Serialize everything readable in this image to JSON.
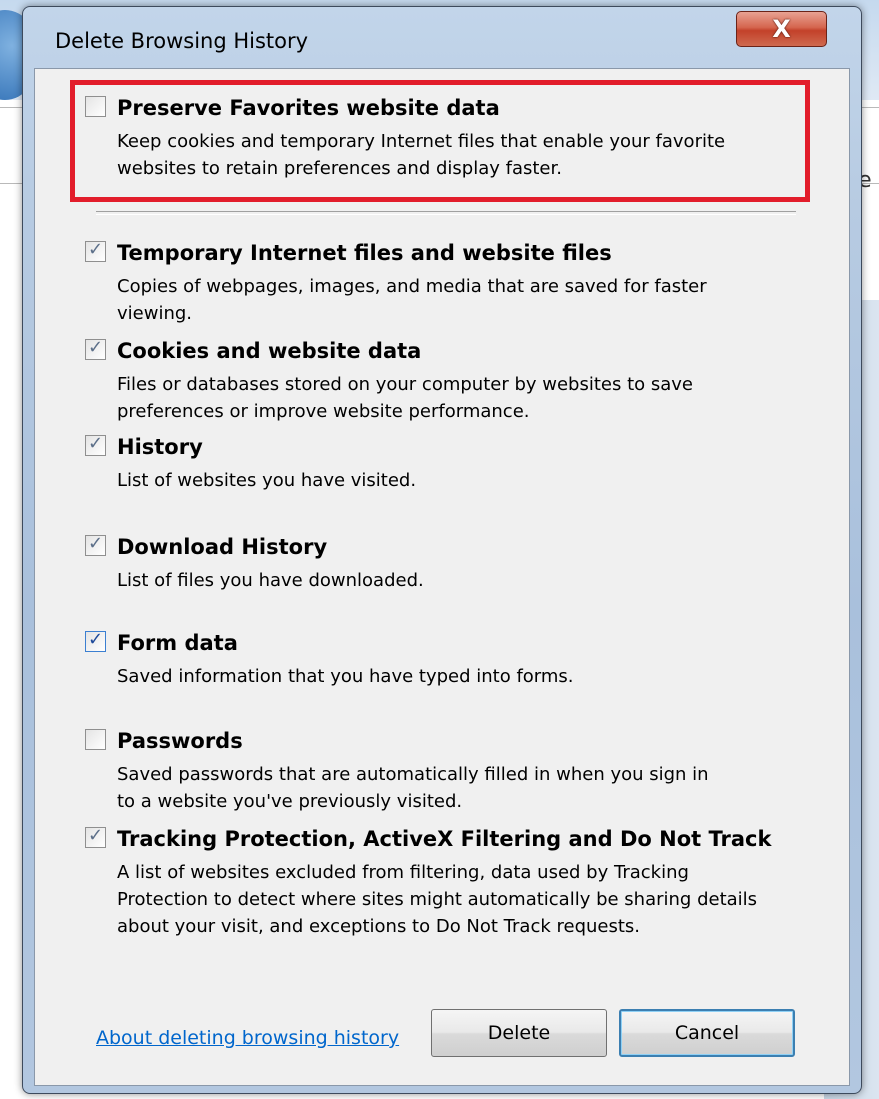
{
  "dialog": {
    "title": "Delete Browsing History",
    "close_label": "X"
  },
  "background": {
    "partial_text": "le"
  },
  "preserve": {
    "checked": false,
    "title": "Preserve Favorites website data",
    "desc": [
      "Keep cookies and temporary Internet files that enable your favorite",
      "websites to retain preferences and display faster."
    ]
  },
  "items": [
    {
      "checked": true,
      "title": "Temporary Internet files and website files",
      "desc": [
        "Copies of webpages, images, and media that are saved for faster",
        "viewing."
      ]
    },
    {
      "checked": true,
      "title": "Cookies and website data",
      "desc": [
        "Files or databases stored on your computer by websites to save",
        "preferences or improve website performance."
      ]
    },
    {
      "checked": true,
      "title": "History",
      "desc": [
        "List of websites you have visited."
      ]
    },
    {
      "checked": true,
      "title": "Download History",
      "desc": [
        "List of files you have downloaded."
      ]
    },
    {
      "checked": true,
      "title": "Form data",
      "desc": [
        "Saved information that you have typed into forms."
      ]
    },
    {
      "checked": false,
      "title": "Passwords",
      "desc": [
        "Saved passwords that are automatically filled in when you sign in",
        "to a website you've previously visited."
      ]
    },
    {
      "checked": true,
      "title": "Tracking Protection, ActiveX Filtering and Do Not Track",
      "desc": [
        "A list of websites excluded from filtering, data used by Tracking",
        "Protection to detect where sites might automatically be sharing details",
        "about your visit, and exceptions to Do Not Track requests."
      ]
    }
  ],
  "footer": {
    "help_link": "About deleting browsing history",
    "delete_label": "Delete",
    "cancel_label": "Cancel"
  },
  "colors": {
    "highlight_border": "#e21d2b",
    "link": "#0066cc",
    "close_button": "#c3412a"
  }
}
